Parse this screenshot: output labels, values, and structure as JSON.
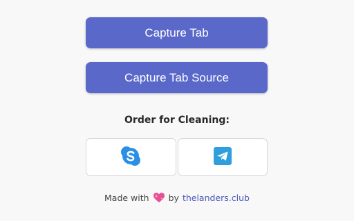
{
  "buttons": {
    "capture_tab": "Capture Tab",
    "capture_tab_source": "Capture Tab Source"
  },
  "order": {
    "title": "Order for Cleaning:",
    "contacts": [
      {
        "icon": "skype-icon",
        "color": "#2c8fe6"
      },
      {
        "icon": "telegram-icon",
        "color": "#2e9fdc"
      }
    ]
  },
  "footer": {
    "made_with": "Made with",
    "heart_icon": "sparkling-heart-icon",
    "by": "by",
    "link_text": "thelanders.club"
  },
  "colors": {
    "accent": "#5a68c9",
    "link": "#4b58b8",
    "background": "#f8f8f8"
  }
}
